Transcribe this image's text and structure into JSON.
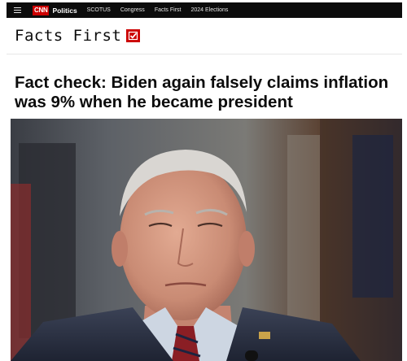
{
  "nav": {
    "brand": "CNN",
    "section": "Politics",
    "links": [
      "SCOTUS",
      "Congress",
      "Facts First",
      "2024 Elections"
    ]
  },
  "facts_first": {
    "title": "Facts First",
    "badge_icon": "checkmark-icon"
  },
  "article": {
    "headline": "Fact check: Biden again falsely claims inflation was 9% when he became president"
  },
  "colors": {
    "brand_red": "#cc0000",
    "nav_bg": "#0c0c0c"
  }
}
